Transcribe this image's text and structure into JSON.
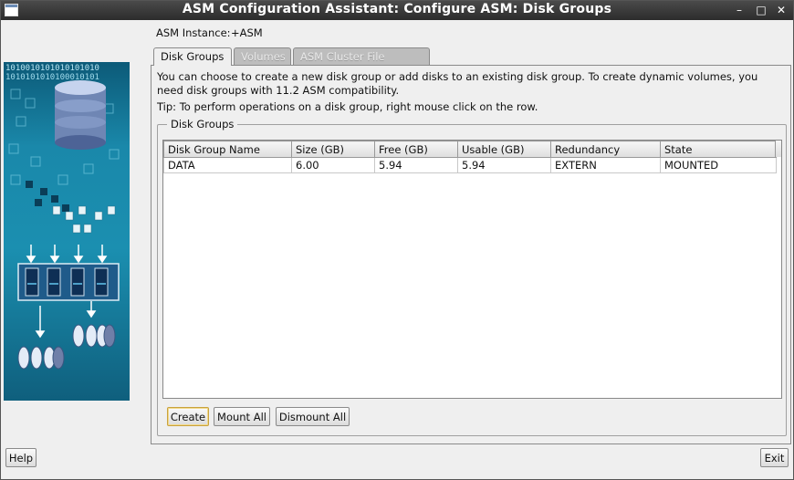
{
  "window": {
    "title": "ASM Configuration Assistant: Configure ASM: Disk Groups",
    "min": "–",
    "max": "□",
    "close": "✕"
  },
  "instance": {
    "label": "ASM Instance:",
    "value": "+ASM"
  },
  "tabs": [
    {
      "label": "Disk Groups",
      "state": "active"
    },
    {
      "label": "Volumes",
      "state": "disabled"
    },
    {
      "label": "ASM Cluster File Systems",
      "state": "disabled"
    }
  ],
  "description": "You can choose to create a new disk group or add disks to an existing disk group. To create dynamic volumes, you need disk groups with 11.2 ASM compatibility.",
  "tip": "Tip: To perform operations on a disk group, right mouse click on the row.",
  "disk_groups": {
    "legend": "Disk Groups",
    "columns": [
      "Disk Group Name",
      "Size (GB)",
      "Free (GB)",
      "Usable (GB)",
      "Redundancy",
      "State"
    ],
    "rows": [
      [
        "DATA",
        "6.00",
        "5.94",
        "5.94",
        "EXTERN",
        "MOUNTED"
      ]
    ]
  },
  "buttons": {
    "create": "Create",
    "mount_all": "Mount All",
    "dismount_all": "Dismount All",
    "help": "Help",
    "exit": "Exit"
  },
  "side_art": {
    "binary_line_1": "1010010101010101010",
    "binary_line_2": "1010101010100010101"
  },
  "colors": {
    "focus_border": "#c9a23e",
    "art_teal": "#1a88aa"
  }
}
